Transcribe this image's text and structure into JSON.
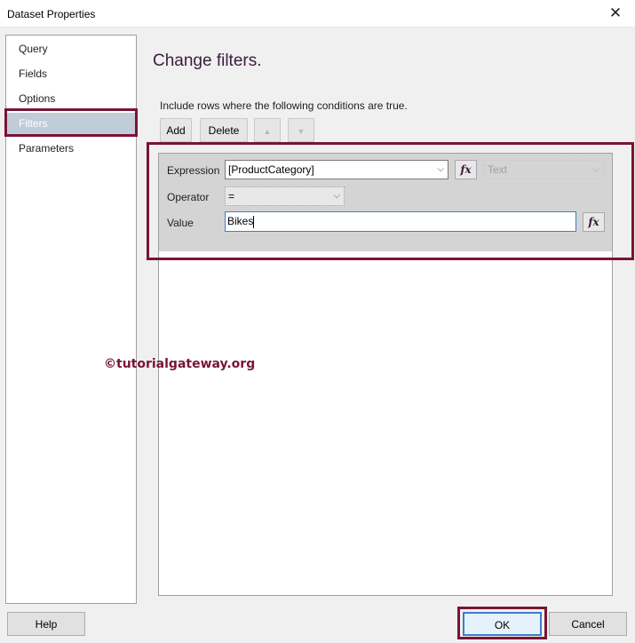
{
  "window": {
    "title": "Dataset Properties",
    "close_glyph": "✕"
  },
  "nav": {
    "items": [
      {
        "label": "Query"
      },
      {
        "label": "Fields"
      },
      {
        "label": "Options"
      },
      {
        "label": "Filters",
        "selected": true
      },
      {
        "label": "Parameters"
      }
    ]
  },
  "main": {
    "heading": "Change filters.",
    "instruction": "Include rows where the following conditions are true.",
    "toolbar": {
      "add_label": "Add",
      "delete_label": "Delete",
      "move_up_icon": "arrow-up-icon",
      "move_down_icon": "arrow-down-icon"
    },
    "filter": {
      "expression_label": "Expression",
      "expression_value": "[ProductCategory]",
      "type_value": "Text",
      "operator_label": "Operator",
      "operator_value": "=",
      "value_label": "Value",
      "value_value": "Bikes",
      "fx_label": "fx"
    }
  },
  "watermark": "©tutorialgateway.org",
  "footer": {
    "help_label": "Help",
    "ok_label": "OK",
    "cancel_label": "Cancel"
  },
  "colors": {
    "highlight": "#7a1432",
    "heading": "#3c1a40",
    "selected_nav": "#c0ccd8"
  }
}
